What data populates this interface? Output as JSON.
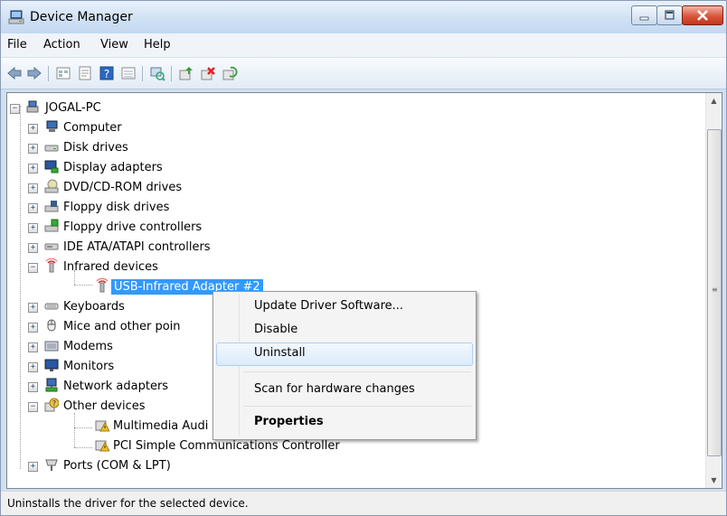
{
  "window": {
    "title": "Device Manager"
  },
  "menubar": {
    "items": [
      "File",
      "Action",
      "View",
      "Help"
    ]
  },
  "tree": {
    "root": "JOGAL-PC",
    "nodes": [
      {
        "label": "Computer",
        "icon": "computer-icon"
      },
      {
        "label": "Disk drives",
        "icon": "disk-drive-icon"
      },
      {
        "label": "Display adapters",
        "icon": "display-adapter-icon"
      },
      {
        "label": "DVD/CD-ROM drives",
        "icon": "dvd-drive-icon"
      },
      {
        "label": "Floppy disk drives",
        "icon": "floppy-disk-icon"
      },
      {
        "label": "Floppy drive controllers",
        "icon": "floppy-controller-icon"
      },
      {
        "label": "IDE ATA/ATAPI controllers",
        "icon": "ide-controller-icon"
      },
      {
        "label": "Infrared devices",
        "icon": "infrared-icon"
      },
      {
        "label": "USB-Infrared Adapter #2",
        "icon": "infrared-icon"
      },
      {
        "label": "Keyboards",
        "icon": "keyboard-icon"
      },
      {
        "label": "Mice and other poin",
        "icon": "mouse-icon"
      },
      {
        "label": "Modems",
        "icon": "modem-icon"
      },
      {
        "label": "Monitors",
        "icon": "monitor-icon"
      },
      {
        "label": "Network adapters",
        "icon": "network-adapter-icon"
      },
      {
        "label": "Other devices",
        "icon": "unknown-device-icon"
      },
      {
        "label": "Multimedia Audi",
        "icon": "warning-device-icon"
      },
      {
        "label": "PCI Simple Communications Controller",
        "icon": "warning-device-icon"
      },
      {
        "label": "Ports (COM & LPT)",
        "icon": "port-icon"
      }
    ]
  },
  "context_menu": {
    "items": [
      "Update Driver Software...",
      "Disable",
      "Uninstall",
      "Scan for hardware changes",
      "Properties"
    ],
    "highlighted": "Uninstall"
  },
  "statusbar": {
    "text": "Uninstalls the driver for the selected device."
  },
  "colors": {
    "selection": "#3399ff",
    "menu_hover": "#dcebfc",
    "title_bar": "#cfe0f3",
    "close_button": "#d9553a"
  }
}
